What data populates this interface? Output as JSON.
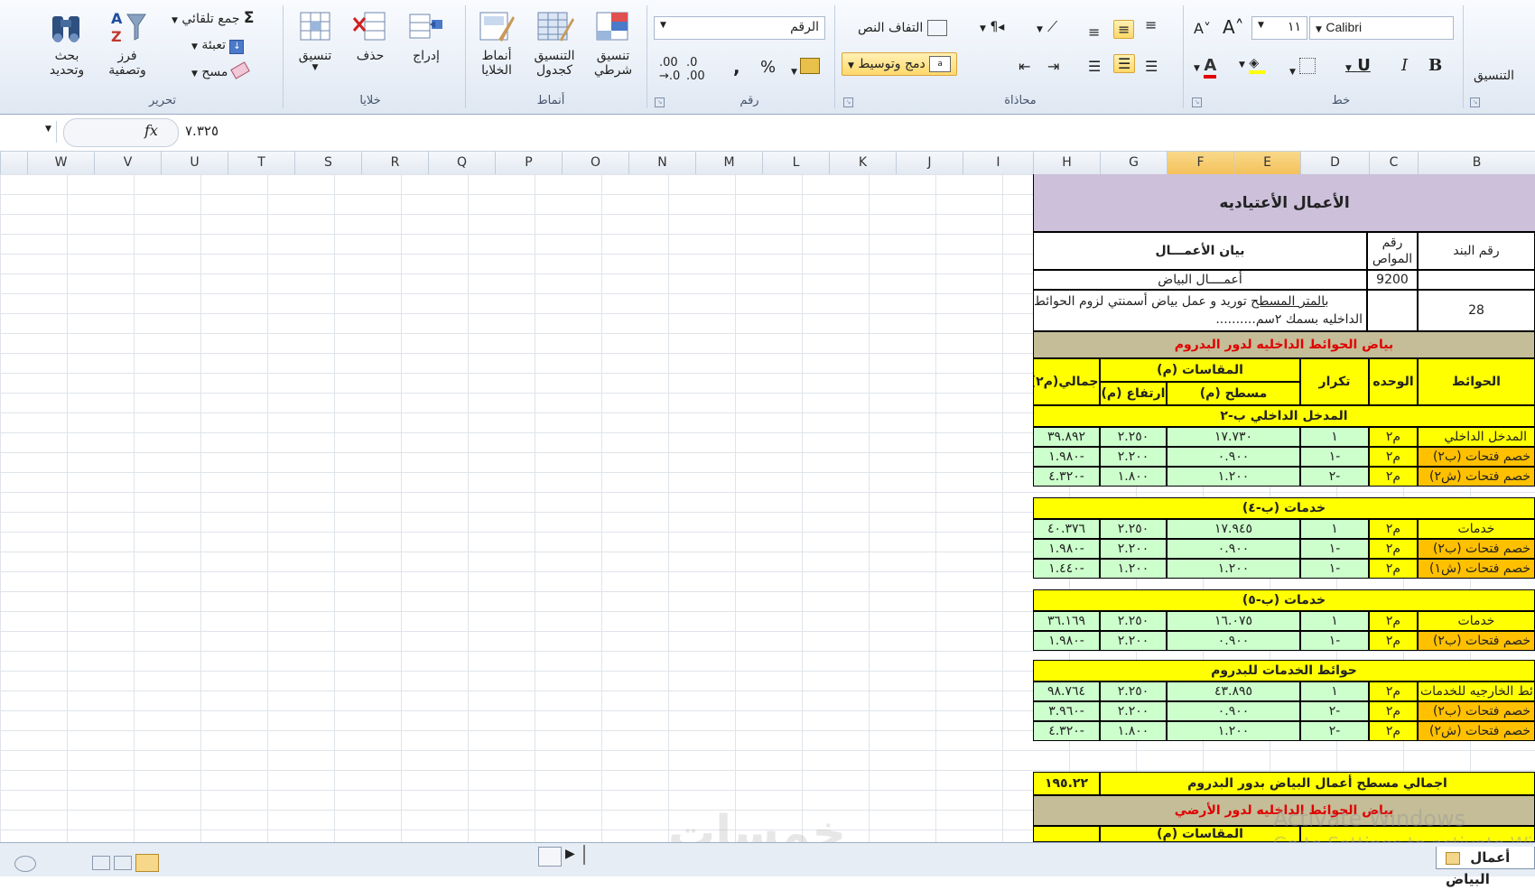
{
  "ribbon": {
    "editing": {
      "group_label": "تحرير",
      "find_select": "بحث وتحديد",
      "sort_filter": "فرز وتصفية",
      "autosum": "جمع تلقائي",
      "fill": "تعبئة",
      "clear": "مسح"
    },
    "cells": {
      "group_label": "خلايا",
      "format": "تنسيق",
      "delete": "حذف",
      "insert": "إدراج"
    },
    "styles": {
      "group_label": "أنماط",
      "cell_styles": "أنماط الخلايا",
      "format_as_table": "التنسيق كجدول",
      "conditional_formatting": "تنسيق شرطي"
    },
    "number": {
      "group_label": "رقم",
      "format_value": "الرقم",
      "percent": "%",
      "comma": ","
    },
    "alignment": {
      "group_label": "محاذاة",
      "wrap_text": "التفاف النص",
      "merge_center": "دمج وتوسيط"
    },
    "font": {
      "group_label": "خط",
      "font_name": "Calibri",
      "font_size": "١١",
      "bold": "B",
      "italic": "I",
      "underline": "U"
    },
    "clipboard": {
      "group_label": "التنسيق"
    }
  },
  "formula_bar": {
    "fx": "fx",
    "value": "٧.٣٢٥"
  },
  "columns": [
    "W",
    "V",
    "U",
    "T",
    "S",
    "R",
    "Q",
    "P",
    "O",
    "N",
    "M",
    "L",
    "K",
    "J",
    "I",
    "H",
    "G",
    "F",
    "E",
    "D",
    "C",
    "B"
  ],
  "sheet": {
    "title": "الأعمال الأعتياديه",
    "hdr_item_no": "رقم البند",
    "hdr_spec_no": "رقم المواص",
    "hdr_description": "بيان الأعمـــال",
    "plaster_works": "أعمــــال البياض",
    "spec_code": "9200",
    "item_no": "28",
    "desc_line1_underlined": "بالمتر المسطح",
    "desc_line1_rest": " توريد و عمل بياض أسمنتي لزوم الحوائط",
    "desc_line2": "الداخليه بسمك ٢سم..........",
    "section1_title": "بياض الحوائط الداخليه لدور البدروم",
    "tbl_walls": "الحوائط",
    "tbl_unit": "الوحده",
    "tbl_repeat": "تكرار",
    "tbl_dims": "المقاسات (م)",
    "tbl_area": "مسطح (م)",
    "tbl_height": "ارتفاع (م)",
    "tbl_total": "اجمالي(م٢)",
    "groups": [
      {
        "title": "المدخل الداخلي ب-٢",
        "rows": [
          {
            "wall": "المدخل الداخلي",
            "unit": "م٢",
            "repeat": "١",
            "area": "١٧.٧٣٠",
            "height": "٢.٢٥٠",
            "total": "٣٩.٨٩٢",
            "highlight": false
          },
          {
            "wall": "خصم فتحات (ب٢)",
            "unit": "م٢",
            "repeat": "١-",
            "area": "٠.٩٠٠",
            "height": "٢.٢٠٠",
            "total": "١.٩٨٠-",
            "highlight": true
          },
          {
            "wall": "خصم فتحات (ش٢)",
            "unit": "م٢",
            "repeat": "٢-",
            "area": "١.٢٠٠",
            "height": "١.٨٠٠",
            "total": "٤.٣٢٠-",
            "highlight": true
          }
        ]
      },
      {
        "title": "خدمات (ب-٤)",
        "rows": [
          {
            "wall": "خدمات",
            "unit": "م٢",
            "repeat": "١",
            "area": "١٧.٩٤٥",
            "height": "٢.٢٥٠",
            "total": "٤٠.٣٧٦",
            "highlight": false
          },
          {
            "wall": "خصم فتحات (ب٢)",
            "unit": "م٢",
            "repeat": "١-",
            "area": "٠.٩٠٠",
            "height": "٢.٢٠٠",
            "total": "١.٩٨٠-",
            "highlight": true
          },
          {
            "wall": "خصم فتحات (ش١)",
            "unit": "م٢",
            "repeat": "١-",
            "area": "١.٢٠٠",
            "height": "١.٢٠٠",
            "total": "١.٤٤٠-",
            "highlight": true
          }
        ]
      },
      {
        "title": "خدمات (ب-٥)",
        "rows": [
          {
            "wall": "خدمات",
            "unit": "م٢",
            "repeat": "١",
            "area": "١٦.٠٧٥",
            "height": "٢.٢٥٠",
            "total": "٣٦.١٦٩",
            "highlight": false
          },
          {
            "wall": "خصم فتحات (ب٢)",
            "unit": "م٢",
            "repeat": "١-",
            "area": "٠.٩٠٠",
            "height": "٢.٢٠٠",
            "total": "١.٩٨٠-",
            "highlight": true
          }
        ]
      },
      {
        "title": "حوائط الخدمات للبدروم",
        "rows": [
          {
            "wall": "حوائط الخارجيه للخدمات",
            "unit": "م٢",
            "repeat": "١",
            "area": "٤٣.٨٩٥",
            "height": "٢.٢٥٠",
            "total": "٩٨.٧٦٤",
            "highlight": false
          },
          {
            "wall": "خصم فتحات (ب٢)",
            "unit": "م٢",
            "repeat": "٢-",
            "area": "٠.٩٠٠",
            "height": "٢.٢٠٠",
            "total": "٣.٩٦٠-",
            "highlight": true
          },
          {
            "wall": "خصم فتحات (ش٢)",
            "unit": "م٢",
            "repeat": "٢-",
            "area": "١.٢٠٠",
            "height": "١.٨٠٠",
            "total": "٤.٣٢٠-",
            "highlight": true
          }
        ]
      }
    ],
    "grand_total_label": "اجمالي مسطح أعمال البياض بدور البدروم",
    "grand_total_value": "١٩٥.٢٢",
    "section2_title": "بياض الحوائط الداخليه لدور الأرضي",
    "section2_dims": "المقاسات (م)"
  },
  "sheet_tab": "أعمال البياض",
  "watermark": {
    "activate_1": "Activate Windows",
    "activate_2": "Go to Settings to activate Windows.",
    "logo": "خمسات"
  },
  "colors": {
    "yellow": "#ffff00",
    "green": "#ccffcc",
    "tan": "#c4bd97",
    "orange": "#ffc000",
    "lavender": "#ccc0da",
    "red_text": "#e00000"
  }
}
